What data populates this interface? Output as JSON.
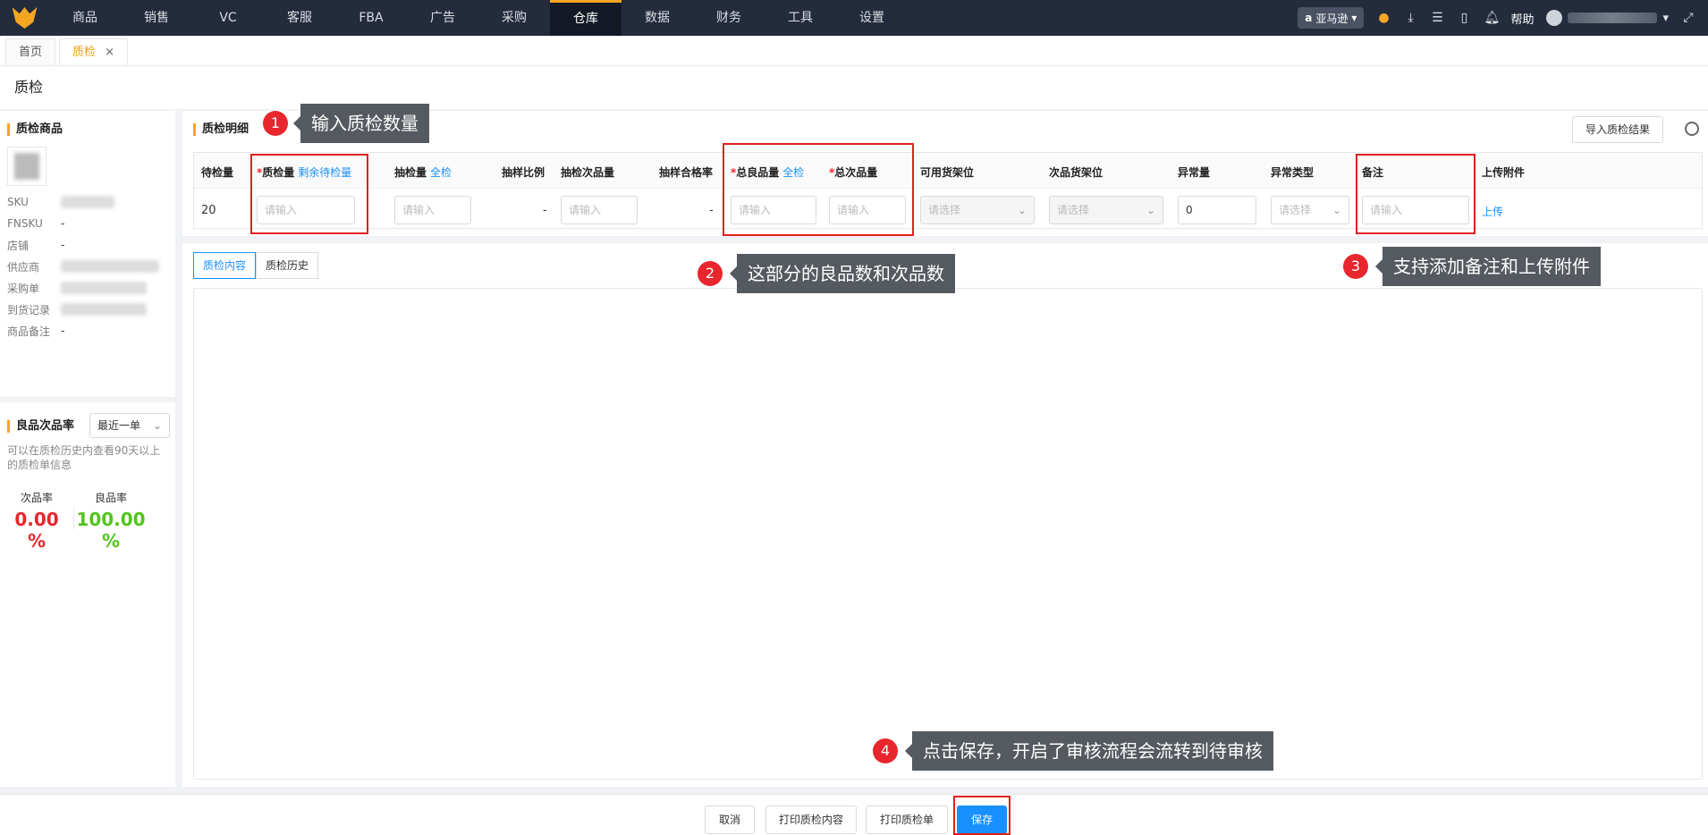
{
  "topnav": {
    "items": [
      "商品",
      "销售",
      "VC",
      "客服",
      "FBA",
      "广告",
      "采购",
      "仓库",
      "数据",
      "财务",
      "工具",
      "设置"
    ],
    "active_index": 7,
    "store": "亚马逊",
    "help": "帮助"
  },
  "page_tabs": [
    {
      "label": "首页"
    },
    {
      "label": "质检",
      "closable": true
    }
  ],
  "close_symbol": "×",
  "page_title": "质检",
  "left": {
    "section_title": "质检商品",
    "info": [
      {
        "key": "SKU",
        "value": ""
      },
      {
        "key": "FNSKU",
        "value": "-"
      },
      {
        "key": "店铺",
        "value": "-"
      },
      {
        "key": "供应商",
        "value": ""
      },
      {
        "key": "采购单",
        "value": ""
      },
      {
        "key": "到货记录",
        "value": ""
      },
      {
        "key": "商品备注",
        "value": "-"
      }
    ],
    "rate_title": "良品次品率",
    "rate_select": "最近一单",
    "hint": "可以在质检历史内查看90天以上的质检单信息",
    "defect_label": "次品率",
    "defect_value": "0.00",
    "good_label": "良品率",
    "good_value": "100.00",
    "pct": "%"
  },
  "detail": {
    "title": "质检明细",
    "import_button": "导入质检结果",
    "headers": {
      "pending": "待检量",
      "qc_qty": "质检量",
      "qc_qty_link": "剩余待检量",
      "sample_qty": "抽检量",
      "sample_link": "全检",
      "sample_ratio": "抽样比例",
      "sample_defect": "抽检次品量",
      "sample_pass": "抽样合格率",
      "total_good": "总良品量",
      "total_good_link": "全检",
      "total_defect": "总次品量",
      "avail_shelf": "可用货架位",
      "defect_shelf": "次品货架位",
      "abnormal_qty": "异常量",
      "abnormal_type": "异常类型",
      "remark": "备注",
      "attachment": "上传附件"
    },
    "row": {
      "pending": "20",
      "input_placeholder": "请输入",
      "select_placeholder": "请选择",
      "ratio": "-",
      "pass_rate": "-",
      "abnormal_qty": "0",
      "upload": "上传"
    }
  },
  "subtabs": [
    "质检内容",
    "质检历史"
  ],
  "footer": {
    "cancel": "取消",
    "print_content": "打印质检内容",
    "print_sheet": "打印质检单",
    "save": "保存"
  },
  "annotations": [
    {
      "num": "1",
      "text": "输入质检数量"
    },
    {
      "num": "2",
      "text": "这部分的良品数和次品数"
    },
    {
      "num": "3",
      "text": "支持添加备注和上传附件"
    },
    {
      "num": "4",
      "text": "点击保存，开启了审核流程会流转到待审核"
    }
  ],
  "colors": {
    "accent": "#f5a623",
    "primary": "#1890ff",
    "defect": "#e8262d",
    "good": "#52c41a",
    "annotation": "#e02020"
  }
}
